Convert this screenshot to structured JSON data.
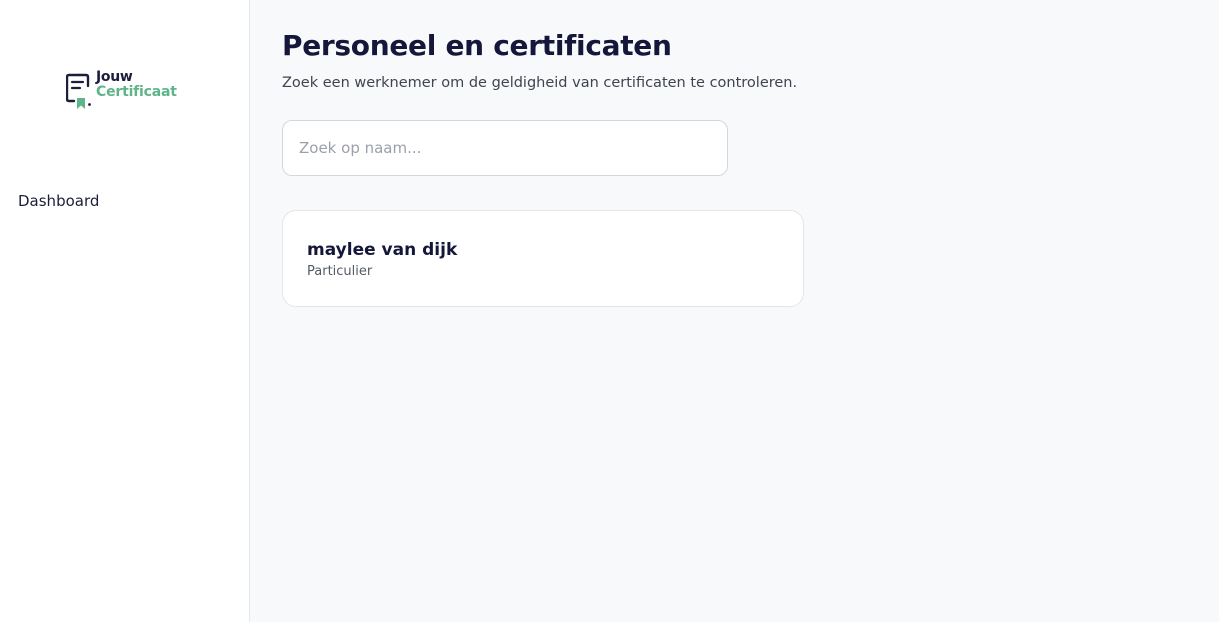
{
  "brand": {
    "line1": "Jouw",
    "line2": "Certificaat",
    "colors": {
      "dark": "#1b1f3b",
      "green": "#5fb58a"
    }
  },
  "sidebar": {
    "items": [
      {
        "label": "Dashboard"
      }
    ]
  },
  "main": {
    "title": "Personeel en certificaten",
    "subtitle": "Zoek een werknemer om de geldigheid van certificaten te controleren.",
    "search": {
      "placeholder": "Zoek op naam...",
      "value": ""
    },
    "employees": [
      {
        "name": "maylee van dijk",
        "type": "Particulier"
      }
    ]
  }
}
